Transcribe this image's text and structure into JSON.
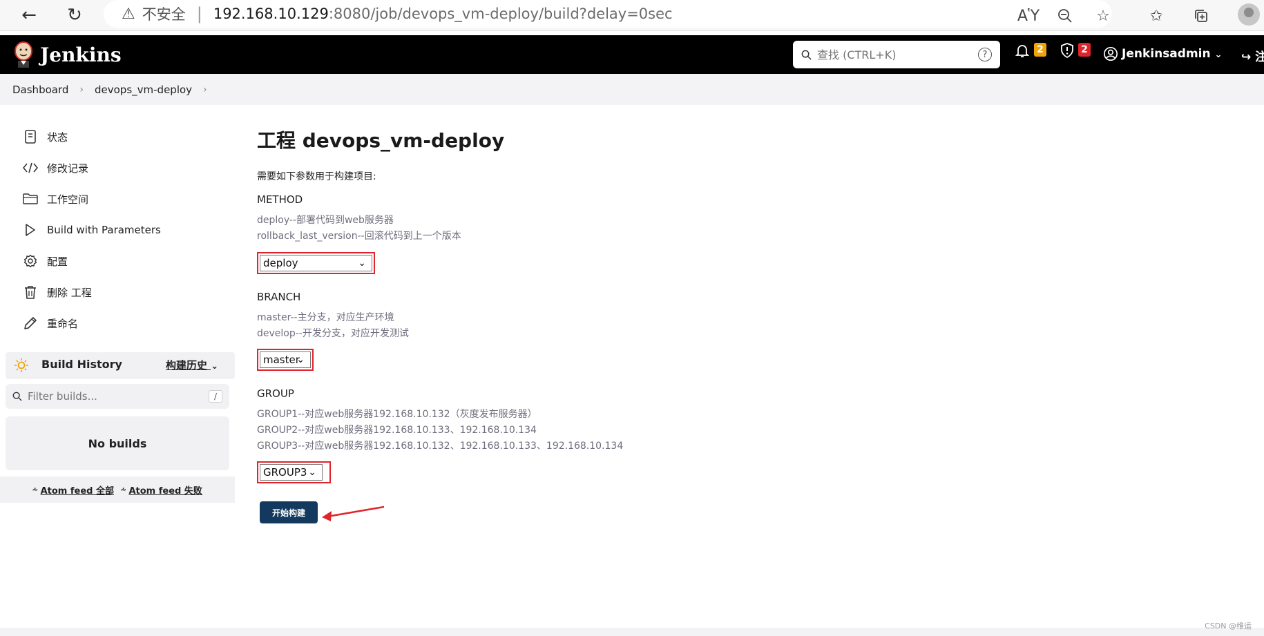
{
  "browser": {
    "insecure_label": "不安全",
    "url_host": "192.168.10.129",
    "url_path": ":8080/job/devops_vm-deploy/build?delay=0sec"
  },
  "header": {
    "brand": "Jenkins",
    "search_placeholder": "查找 (CTRL+K)",
    "notifications_count": "2",
    "security_count": "2",
    "user": "Jenkinsadmin",
    "logout": "注销"
  },
  "breadcrumb": [
    "Dashboard",
    "devops_vm-deploy"
  ],
  "sidebar": {
    "items": [
      {
        "label": "状态",
        "icon": "document-icon"
      },
      {
        "label": "修改记录",
        "icon": "code-icon"
      },
      {
        "label": "工作空间",
        "icon": "folder-icon"
      },
      {
        "label": "Build with Parameters",
        "icon": "play-icon"
      },
      {
        "label": "配置",
        "icon": "gear-icon"
      },
      {
        "label": "删除 工程",
        "icon": "trash-icon"
      },
      {
        "label": "重命名",
        "icon": "pencil-icon"
      }
    ],
    "build_history": {
      "title": "Build History",
      "label_cn": "构建历史",
      "filter_placeholder": "Filter builds...",
      "filter_shortcut": "/",
      "empty": "No builds",
      "atom_all": "Atom feed 全部",
      "atom_fail": "Atom feed 失败"
    }
  },
  "main": {
    "title": "工程 devops_vm-deploy",
    "intro": "需要如下参数用于构建项目:",
    "params": [
      {
        "name": "METHOD",
        "desc": [
          "deploy--部署代码到web服务器",
          "rollback_last_version--回滚代码到上一个版本"
        ],
        "value": "deploy"
      },
      {
        "name": "BRANCH",
        "desc": [
          "master--主分支，对应生产环境",
          "develop--开发分支，对应开发测试"
        ],
        "value": "master"
      },
      {
        "name": "GROUP",
        "desc": [
          "GROUP1--对应web服务器192.168.10.132（灰度发布服务器）",
          "GROUP2--对应web服务器192.168.10.133、192.168.10.134",
          "GROUP3--对应web服务器192.168.10.132、192.168.10.133、192.168.10.134"
        ],
        "value": "GROUP3"
      }
    ],
    "build_button": "开始构建"
  },
  "watermark": "CSDN @维运",
  "colors": {
    "accent": "#133a5e",
    "highlight": "#e0242b",
    "badge_warn": "#f0a30a",
    "badge_alert": "#e0242b"
  }
}
